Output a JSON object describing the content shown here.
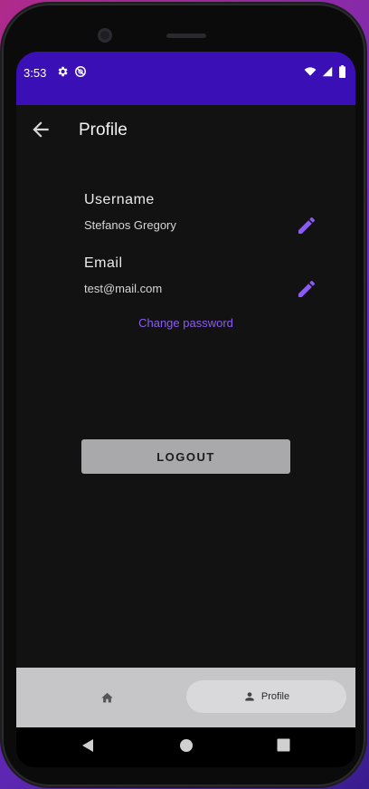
{
  "status_bar": {
    "time": "3:53",
    "icons_left": [
      "gear-icon",
      "no-disturb-icon"
    ],
    "icons_right": [
      "wifi-icon",
      "signal-icon",
      "battery-icon"
    ],
    "background": "#3b0fb6"
  },
  "app_bar": {
    "title": "Profile",
    "back_icon": "arrow-back-icon"
  },
  "profile": {
    "username_label": "Username",
    "username_value": "Stefanos Gregory",
    "email_label": "Email",
    "email_value": "test@mail.com",
    "edit_icon": "pencil-icon",
    "change_password": "Change password",
    "logout": "LOGOUT",
    "accent": "#8b5cf0"
  },
  "bottom_nav": {
    "items": [
      {
        "icon": "home-icon",
        "label": ""
      },
      {
        "icon": "person-icon",
        "label": "Profile",
        "selected": true
      }
    ]
  },
  "system_nav": [
    "back-triangle-icon",
    "home-circle-icon",
    "recents-square-icon"
  ]
}
